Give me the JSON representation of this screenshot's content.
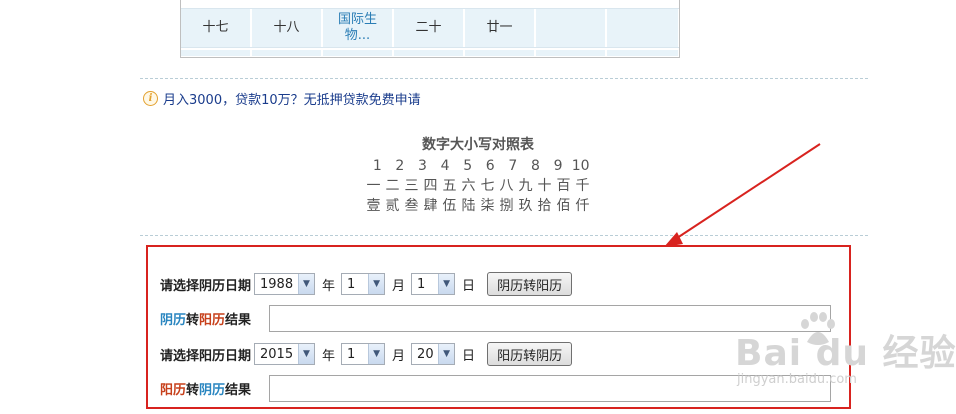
{
  "calendar": {
    "cells": [
      "十七",
      "十八",
      "国际生\n物...",
      "二十",
      "廿一",
      "",
      ""
    ]
  },
  "ad": {
    "text": "月入3000，贷款10万？无抵押贷款免费申请",
    "icon": "info-icon"
  },
  "number_table": {
    "title": "数字大小写对照表",
    "arabic": [
      "1",
      "2",
      "3",
      "4",
      "5",
      "6",
      "7",
      "8",
      "9",
      "10"
    ],
    "lower": [
      "一",
      "二",
      "三",
      "四",
      "五",
      "六",
      "七",
      "八",
      "九",
      "十",
      "百",
      "千"
    ],
    "upper": [
      "壹",
      "贰",
      "叁",
      "肆",
      "伍",
      "陆",
      "柒",
      "捌",
      "玖",
      "拾",
      "佰",
      "仟"
    ]
  },
  "converter": {
    "lunar_label": "请选择阴历日期",
    "lunar_year": "1988",
    "lunar_month": "1",
    "lunar_day": "1",
    "year_unit": "年",
    "month_unit": "月",
    "day_unit": "日",
    "lunar_button": "阴历转阳历",
    "result1_part1": "阴历",
    "result1_part2": "转",
    "result1_part3": "阳历",
    "result1_part4": "结果",
    "solar_label": "请选择阳历日期",
    "solar_year": "2015",
    "solar_month": "1",
    "solar_day": "20",
    "solar_button": "阳历转阴历",
    "result2_part1": "阳历",
    "result2_part2": "转",
    "result2_part3": "阴历",
    "result2_part4": "结果"
  },
  "watermark": {
    "main": "Bai du 经验",
    "sub": "jingyan.baidu.com"
  },
  "colors": {
    "highlight_box": "#d8231f",
    "blue_text": "#2a86c0",
    "red_text": "#c7401b",
    "link": "#1a3c8c"
  }
}
